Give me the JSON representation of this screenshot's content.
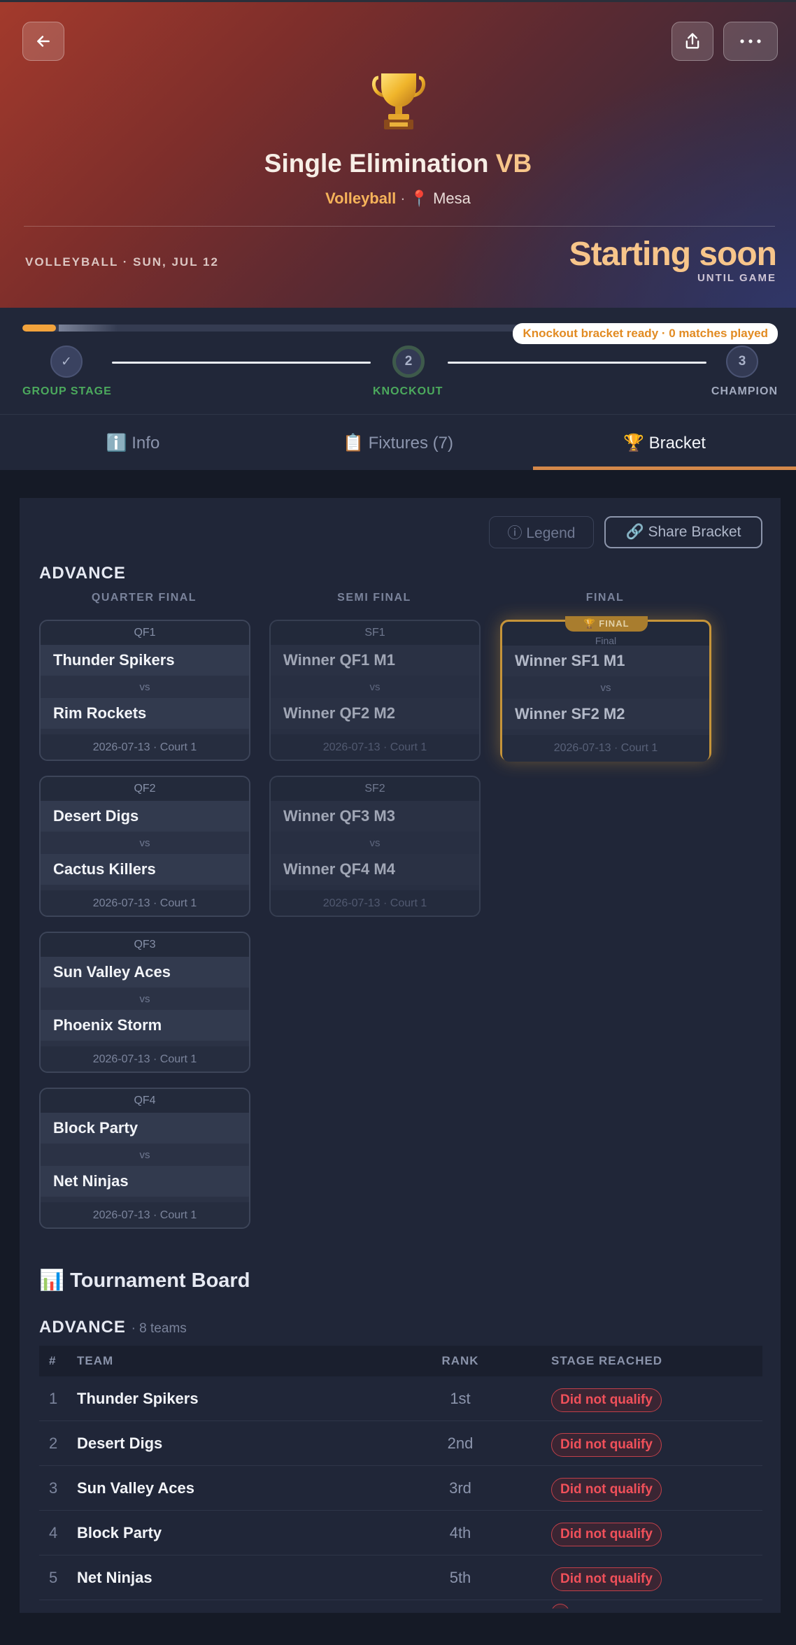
{
  "hero": {
    "title_main": "Single Elimination",
    "title_accent": "VB",
    "sport": "Volleyball",
    "location_icon": "pin-icon",
    "location": "Mesa",
    "meta": "VOLLEYBALL · SUN, JUL 12",
    "status": "Starting soon",
    "status_sub": "UNTIL GAME"
  },
  "progress": {
    "fill": 0.045,
    "badge": "Knockout bracket ready · 0 matches played",
    "steps": [
      {
        "label": "GROUP STAGE",
        "marker": "✓",
        "state": "done"
      },
      {
        "label": "KNOCKOUT",
        "marker": "2",
        "state": "current"
      },
      {
        "label": "CHAMPION",
        "marker": "3",
        "state": "upcoming"
      }
    ]
  },
  "tabs": [
    {
      "label": "ℹ️ Info",
      "active": false
    },
    {
      "label": "📋 Fixtures (7)",
      "active": false
    },
    {
      "label": "🏆 Bracket",
      "active": true
    }
  ],
  "bracket": {
    "legend_label": "ⓘ Legend",
    "share_label": "🔗 Share Bracket",
    "section_title": "ADVANCE",
    "columns": [
      "QUARTER FINAL",
      "SEMI FINAL",
      "FINAL"
    ],
    "vs": "vs",
    "quarter": [
      {
        "code": "QF1",
        "team1": "Thunder Spikers",
        "team2": "Rim Rockets",
        "info": "2026-07-13 · Court 1"
      },
      {
        "code": "QF2",
        "team1": "Desert Digs",
        "team2": "Cactus Killers",
        "info": "2026-07-13 · Court 1"
      },
      {
        "code": "QF3",
        "team1": "Sun Valley Aces",
        "team2": "Phoenix Storm",
        "info": "2026-07-13 · Court 1"
      },
      {
        "code": "QF4",
        "team1": "Block Party",
        "team2": "Net Ninjas",
        "info": "2026-07-13 · Court 1"
      }
    ],
    "semi": [
      {
        "code": "SF1",
        "team1": "Winner QF1 M1",
        "team2": "Winner QF2 M2",
        "info": "2026-07-13 · Court 1"
      },
      {
        "code": "SF2",
        "team1": "Winner QF3 M3",
        "team2": "Winner QF4 M4",
        "info": "2026-07-13 · Court 1"
      }
    ],
    "final": {
      "badge": "🏆 FINAL",
      "code": "Final",
      "team1": "Winner SF1 M1",
      "team2": "Winner SF2 M2",
      "info": "2026-07-13 · Court 1"
    }
  },
  "board": {
    "title": "📊 Tournament Board",
    "group_label": "ADVANCE",
    "group_count": "· 8 teams",
    "columns": [
      "#",
      "TEAM",
      "RANK",
      "STAGE REACHED"
    ],
    "rows": [
      {
        "num": "1",
        "team": "Thunder Spikers",
        "rank": "1st",
        "stage": "Did not qualify"
      },
      {
        "num": "2",
        "team": "Desert Digs",
        "rank": "2nd",
        "stage": "Did not qualify"
      },
      {
        "num": "3",
        "team": "Sun Valley Aces",
        "rank": "3rd",
        "stage": "Did not qualify"
      },
      {
        "num": "4",
        "team": "Block Party",
        "rank": "4th",
        "stage": "Did not qualify"
      },
      {
        "num": "5",
        "team": "Net Ninjas",
        "rank": "5th",
        "stage": "Did not qualify"
      }
    ]
  },
  "colors": {
    "accent": "#f7c58a",
    "progress": "#f2a33c",
    "success": "#4caa5d",
    "final_border": "#d9a03a",
    "danger": "#f0505a"
  }
}
